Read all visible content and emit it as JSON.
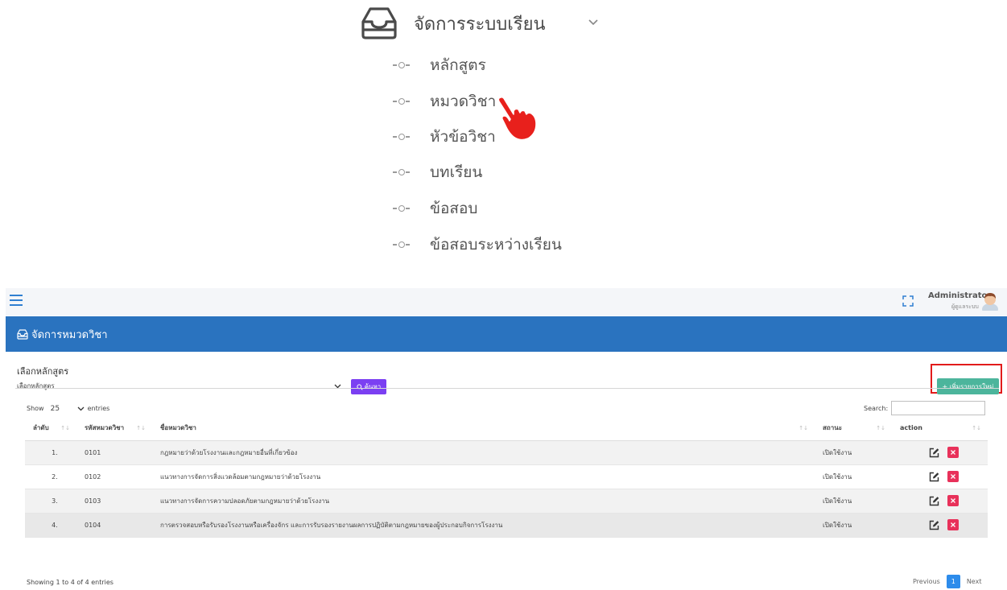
{
  "menu": {
    "title": "จัดการระบบเรียน",
    "items": [
      {
        "label": "หลักสูตร"
      },
      {
        "label": "หมวดวิชา"
      },
      {
        "label": "หัวข้อวิชา"
      },
      {
        "label": "บทเรียน"
      },
      {
        "label": "ข้อสอบ"
      },
      {
        "label": "ข้อสอบระหว่างเรียน"
      }
    ]
  },
  "topbar": {
    "user_name": "Administrator",
    "user_role": "ผู้ดูแลระบบ"
  },
  "page": {
    "title": "จัดการหมวดวิชา"
  },
  "filter": {
    "label": "เลือกหลักสูตร",
    "select_value": "เลือกหลักสูตร",
    "search_button": "ค้นหา",
    "add_button": "+ เพิ่มรายการใหม่"
  },
  "table_controls": {
    "show_label": "Show",
    "page_length": "25",
    "entries_label": "entries",
    "search_label": "Search:"
  },
  "table": {
    "headers": {
      "no": "ลำดับ",
      "code": "รหัสหมวดวิชา",
      "name": "ชื่อหมวดวิชา",
      "status": "สถานะ",
      "action": "action"
    },
    "rows": [
      {
        "no": "1.",
        "code": "0101",
        "name": "กฎหมายว่าด้วยโรงงานและกฎหมายอื่นที่เกี่ยวข้อง",
        "status": "เปิดใช้งาน"
      },
      {
        "no": "2.",
        "code": "0102",
        "name": "แนวทางการจัดการสิ่งแวดล้อมตามกฎหมายว่าด้วยโรงงาน",
        "status": "เปิดใช้งาน"
      },
      {
        "no": "3.",
        "code": "0103",
        "name": "แนวทางการจัดการความปลอดภัยตามกฎหมายว่าด้วยโรงงาน",
        "status": "เปิดใช้งาน"
      },
      {
        "no": "4.",
        "code": "0104",
        "name": "การตรวจสอบหรือรับรองโรงงานหรือเครื่องจักร และการรับรองรายงานผลการปฏิบัติตามกฎหมายของผู้ประกอบกิจการโรงงาน",
        "status": "เปิดใช้งาน"
      }
    ]
  },
  "footer": {
    "info": "Showing 1 to 4 of 4 entries",
    "previous": "Previous",
    "current_page": "1",
    "next": "Next"
  },
  "colors": {
    "banner": "#2a73bf",
    "search_button": "#7b3ff2",
    "add_button": "#4cb59c",
    "highlight": "#e21b1b",
    "delete": "#e8315a",
    "pager_active": "#2d8ceb"
  }
}
